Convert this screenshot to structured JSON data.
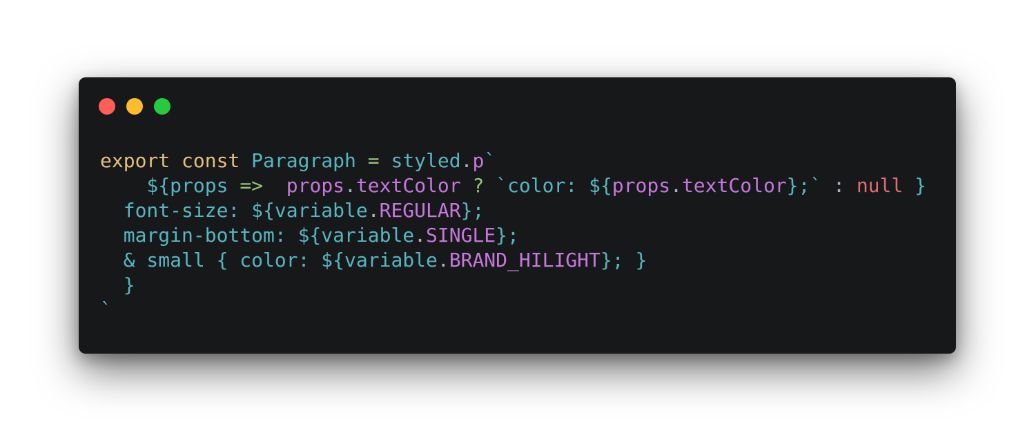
{
  "window": {
    "background": "#17181a",
    "controls": [
      {
        "name": "close",
        "color": "#ff5f56"
      },
      {
        "name": "minimize",
        "color": "#ffbd2e"
      },
      {
        "name": "zoom",
        "color": "#27c93f"
      }
    ]
  },
  "palette": {
    "keyword": "#e5c07b",
    "identifier": "#56b6c2",
    "property": "#c678dd",
    "operator": "#98c379",
    "null": "#e06c75",
    "punct": "#abb2bf"
  },
  "code": {
    "lines": [
      [
        {
          "t": "export",
          "c": "keyword"
        },
        {
          "t": " ",
          "c": "punct"
        },
        {
          "t": "const",
          "c": "keyword"
        },
        {
          "t": " ",
          "c": "punct"
        },
        {
          "t": "Paragraph",
          "c": "identifier"
        },
        {
          "t": " ",
          "c": "punct"
        },
        {
          "t": "=",
          "c": "operator"
        },
        {
          "t": " ",
          "c": "punct"
        },
        {
          "t": "styled",
          "c": "identifier"
        },
        {
          "t": ".",
          "c": "punct"
        },
        {
          "t": "p",
          "c": "property"
        },
        {
          "t": "`",
          "c": "identifier"
        }
      ],
      [
        {
          "t": "    ${",
          "c": "identifier"
        },
        {
          "t": "props",
          "c": "identifier"
        },
        {
          "t": " ",
          "c": "punct"
        },
        {
          "t": "=>",
          "c": "operator"
        },
        {
          "t": "  ",
          "c": "punct"
        },
        {
          "t": "props",
          "c": "property"
        },
        {
          "t": ".",
          "c": "punct"
        },
        {
          "t": "textColor",
          "c": "property"
        },
        {
          "t": " ",
          "c": "punct"
        },
        {
          "t": "?",
          "c": "operator"
        },
        {
          "t": " ",
          "c": "punct"
        },
        {
          "t": "`color: ${",
          "c": "identifier"
        },
        {
          "t": "props",
          "c": "property"
        },
        {
          "t": ".",
          "c": "punct"
        },
        {
          "t": "textColor",
          "c": "property"
        },
        {
          "t": "};`",
          "c": "identifier"
        },
        {
          "t": " ",
          "c": "punct"
        },
        {
          "t": ":",
          "c": "punct"
        },
        {
          "t": " ",
          "c": "punct"
        },
        {
          "t": "null",
          "c": "null"
        },
        {
          "t": " ",
          "c": "punct"
        },
        {
          "t": "}",
          "c": "identifier"
        }
      ],
      [
        {
          "t": "  font-size: ${",
          "c": "identifier"
        },
        {
          "t": "variable",
          "c": "identifier"
        },
        {
          "t": ".",
          "c": "punct"
        },
        {
          "t": "REGULAR",
          "c": "property"
        },
        {
          "t": "};",
          "c": "identifier"
        }
      ],
      [
        {
          "t": "  margin-bottom: ${",
          "c": "identifier"
        },
        {
          "t": "variable",
          "c": "identifier"
        },
        {
          "t": ".",
          "c": "punct"
        },
        {
          "t": "SINGLE",
          "c": "property"
        },
        {
          "t": "};",
          "c": "identifier"
        }
      ],
      [
        {
          "t": "  & small { color: ${",
          "c": "identifier"
        },
        {
          "t": "variable",
          "c": "identifier"
        },
        {
          "t": ".",
          "c": "punct"
        },
        {
          "t": "BRAND_HILIGHT",
          "c": "property"
        },
        {
          "t": "}; }",
          "c": "identifier"
        }
      ],
      [
        {
          "t": "  }",
          "c": "identifier"
        }
      ],
      [
        {
          "t": "`",
          "c": "identifier"
        }
      ]
    ]
  }
}
